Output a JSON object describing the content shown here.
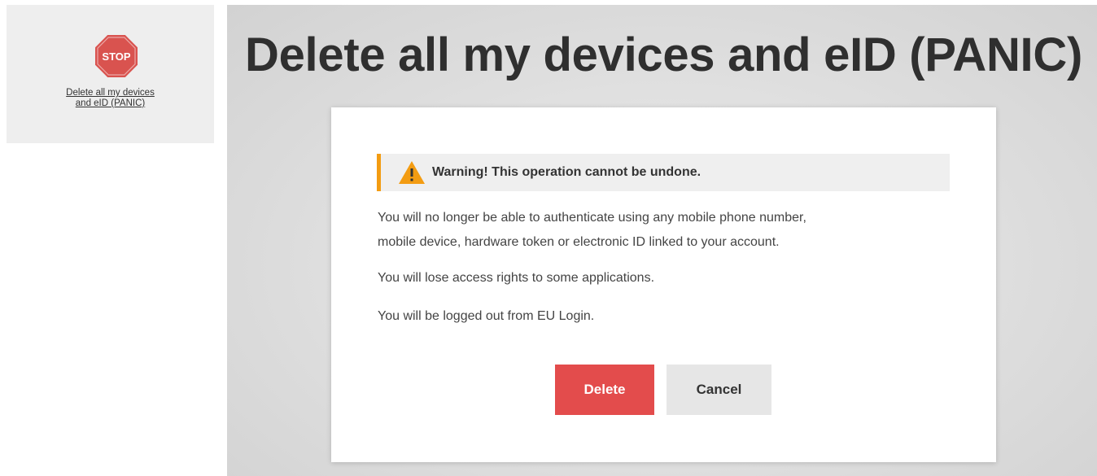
{
  "tile": {
    "stop_sign_text": "STOP",
    "link_line1": "Delete all my devices",
    "link_line2": "and eID (PANIC)"
  },
  "dialog": {
    "heading": "Delete all my devices and eID (PANIC)",
    "warning": "Warning! This operation cannot be undone.",
    "messages": [
      "You will no longer be able to authenticate using any mobile phone number,",
      "mobile device, hardware token or electronic ID linked to your account.",
      "You will lose access rights to some applications.",
      "You will be logged out from EU Login."
    ],
    "delete_label": "Delete",
    "cancel_label": "Cancel"
  },
  "icons": {
    "stop": "stop-sign-icon",
    "warning": "warning-triangle-icon"
  },
  "colors": {
    "stop_red": "#d9534f",
    "warning_orange": "#f39c12",
    "delete_button": "#e34c4c",
    "cancel_button": "#e6e6e6"
  }
}
